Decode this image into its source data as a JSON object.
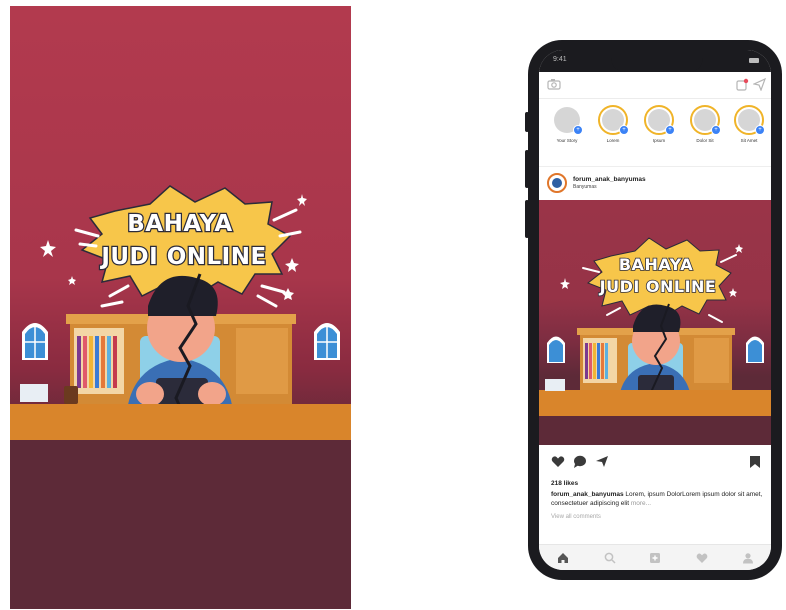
{
  "poster": {
    "title_line1": "BAHAYA",
    "title_line2": "JUDI ONLINE"
  },
  "phone": {
    "status_time": "9:41",
    "stories": [
      {
        "label": "Your Story",
        "own": true
      },
      {
        "label": "Lorem",
        "own": false
      },
      {
        "label": "Ipsum",
        "own": false
      },
      {
        "label": "Dolor Sit",
        "own": false
      },
      {
        "label": "Sit Amet",
        "own": false
      }
    ],
    "post": {
      "username": "forum_anak_banyumas",
      "location": "Banyumas",
      "image_title_line1": "BAHAYA",
      "image_title_line2": "JUDI ONLINE",
      "likes": "218 likes",
      "caption_user": "forum_anak_banyumas",
      "caption_text": " Lorem, ipsum DolorLorem ipsum dolor sit amet, consectetuer adipiscing elit",
      "caption_more": " more...",
      "view_all": "View all comments"
    }
  },
  "colors": {
    "poster_top": "#b23a4e",
    "poster_bottom": "#5d2a38",
    "burst": "#f7c64a",
    "floor": "#d9852b",
    "story_ring": "#f0b429",
    "story_plus": "#3b82f6",
    "phone_frame": "#1b1b1f"
  },
  "icons": [
    "camera-icon",
    "activity-icon",
    "send-icon",
    "heart-icon",
    "comment-icon",
    "share-icon",
    "bookmark-icon",
    "home-icon",
    "search-icon",
    "add-post-icon",
    "likes-icon",
    "profile-icon"
  ]
}
